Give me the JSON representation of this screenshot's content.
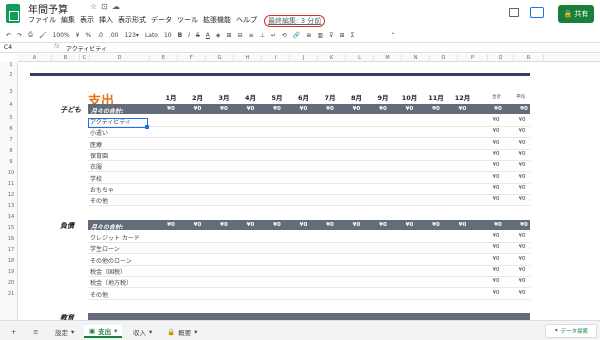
{
  "app": {
    "title": "年間予算",
    "last_edit": "最終編集: 3 分前"
  },
  "menu": [
    "ファイル",
    "編集",
    "表示",
    "挿入",
    "表示形式",
    "データ",
    "ツール",
    "拡張機能",
    "ヘルプ"
  ],
  "header": {
    "share_label": "共有"
  },
  "toolbar": {
    "zoom": "100%",
    "currency": "¥",
    "percent": "%",
    "decimals_dec": ".0",
    "decimals_inc": ".00",
    "format": "123▾",
    "font": "Lato",
    "font_size": "10"
  },
  "formula": {
    "namebox": "C4",
    "fx": "fx",
    "value": "アクティビティ"
  },
  "columns": [
    "A",
    "B",
    "C",
    "D",
    "E",
    "F",
    "G",
    "H",
    "I",
    "J",
    "K",
    "L",
    "M",
    "N",
    "O",
    "P",
    "Q",
    "R"
  ],
  "rows": [
    "1",
    "2",
    "3",
    "4",
    "5",
    "6",
    "7",
    "8",
    "9",
    "10",
    "11",
    "12",
    "13",
    "14",
    "15",
    "16",
    "17",
    "18",
    "19",
    "20",
    "21"
  ],
  "sheet": {
    "section_title": "支出",
    "months": [
      "1月",
      "2月",
      "3月",
      "4月",
      "5月",
      "6月",
      "7月",
      "8月",
      "9月",
      "10月",
      "11月",
      "12月"
    ],
    "total_label": "合計",
    "avg_label": "平均",
    "zero": "¥0",
    "groups": [
      {
        "category": "子ども",
        "header": "月々の合計:",
        "items": [
          "アクティビティ",
          "小遣い",
          "医療",
          "保育園",
          "衣服",
          "学校",
          "おもちゃ",
          "その他"
        ]
      },
      {
        "category": "負債",
        "header": "月々の合計:",
        "items": [
          "クレジット カード",
          "学生ローン",
          "その他のローン",
          "税金（国税）",
          "税金（地方税）",
          "その他"
        ]
      }
    ],
    "third_category": "教育"
  },
  "tabs": [
    {
      "label": "設定",
      "active": false
    },
    {
      "label": "支出",
      "active": true
    },
    {
      "label": "収入",
      "active": false
    },
    {
      "label": "概要",
      "active": false
    }
  ],
  "explore": {
    "label": "データ探索"
  },
  "colors": {
    "navy": "#34405a",
    "header_gray": "#646c7a",
    "orange": "#e8711a",
    "green": "#188038"
  }
}
